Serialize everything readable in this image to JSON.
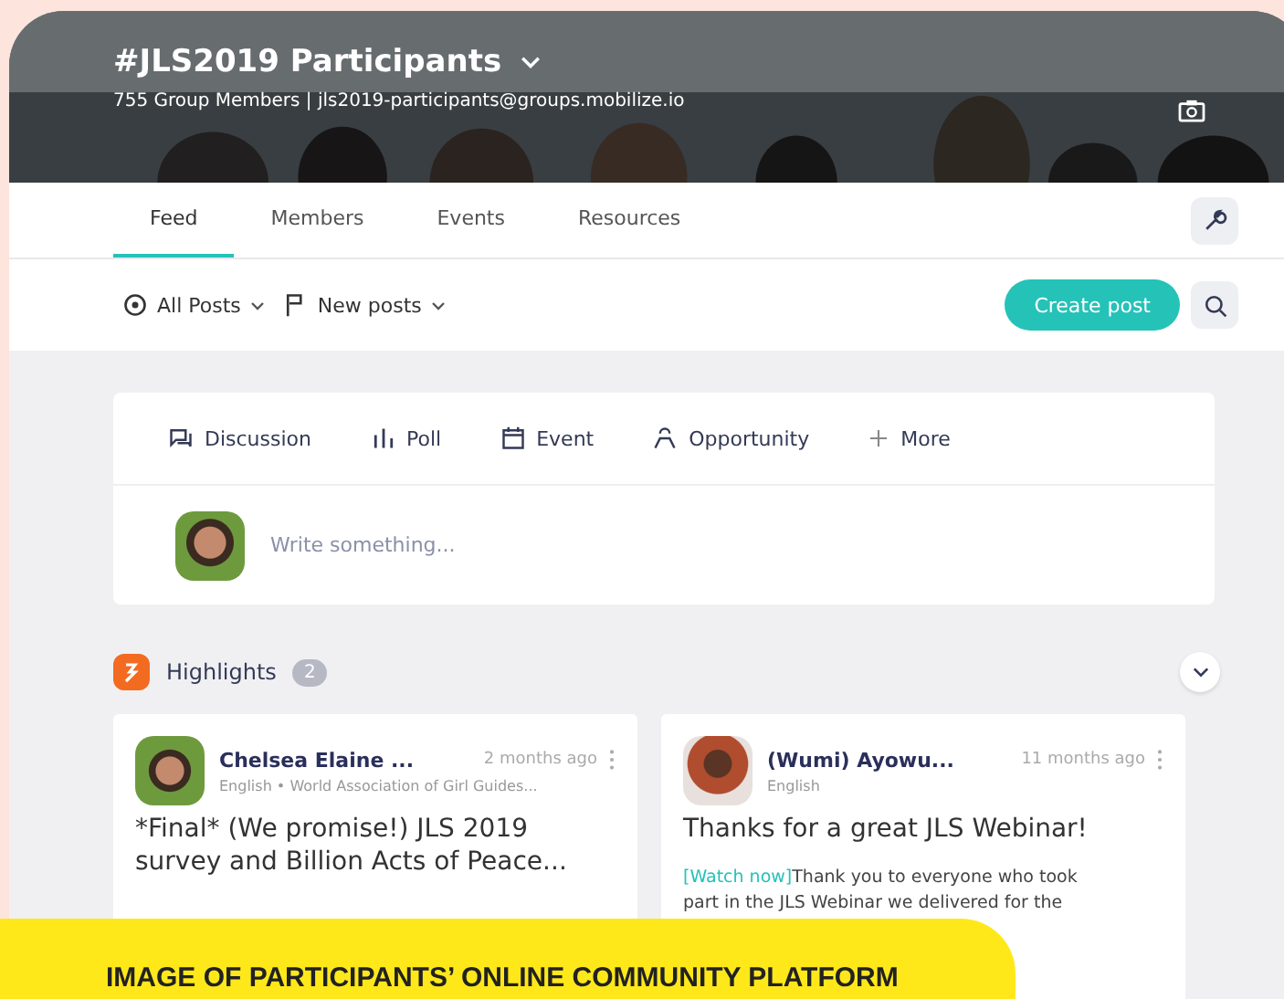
{
  "group": {
    "title": "#JLS2019 Participants",
    "subtitle": "755 Group Members | jls2019-participants@groups.mobilize.io"
  },
  "tabs": [
    {
      "label": "Feed",
      "selected": true
    },
    {
      "label": "Members",
      "selected": false
    },
    {
      "label": "Events",
      "selected": false
    },
    {
      "label": "Resources",
      "selected": false
    }
  ],
  "filters": [
    {
      "kind": "all",
      "label": "All Posts"
    },
    {
      "kind": "flag",
      "label": "New posts"
    }
  ],
  "create_button": "Create post",
  "composer": {
    "types": [
      {
        "kind": "discussion",
        "label": "Discussion"
      },
      {
        "kind": "poll",
        "label": "Poll"
      },
      {
        "kind": "event",
        "label": "Event"
      },
      {
        "kind": "opportunity",
        "label": "Opportunity"
      },
      {
        "kind": "more",
        "label": "More"
      }
    ],
    "placeholder": "Write something..."
  },
  "highlights": {
    "label": "Highlights",
    "count": "2"
  },
  "posts": [
    {
      "author": "Chelsea Elaine ...",
      "time": "2 months ago",
      "meta": "English • World Association of Girl Guides...",
      "title": "*Final* (We promise!) JLS 2019 survey and Billion Acts of Peace..."
    },
    {
      "author": "(Wumi) Ayowu...",
      "time": "11 months ago",
      "meta": "English",
      "title": "Thanks for a great JLS Webinar!",
      "body": [
        {
          "link": "[Watch now]",
          "text": "Thank you to everyone who took"
        },
        {
          "text": "part in the JLS Webinar we delivered for the"
        }
      ]
    }
  ],
  "caption": "IMAGE OF PARTICIPANTS’ ONLINE COMMUNITY PLATFORM"
}
